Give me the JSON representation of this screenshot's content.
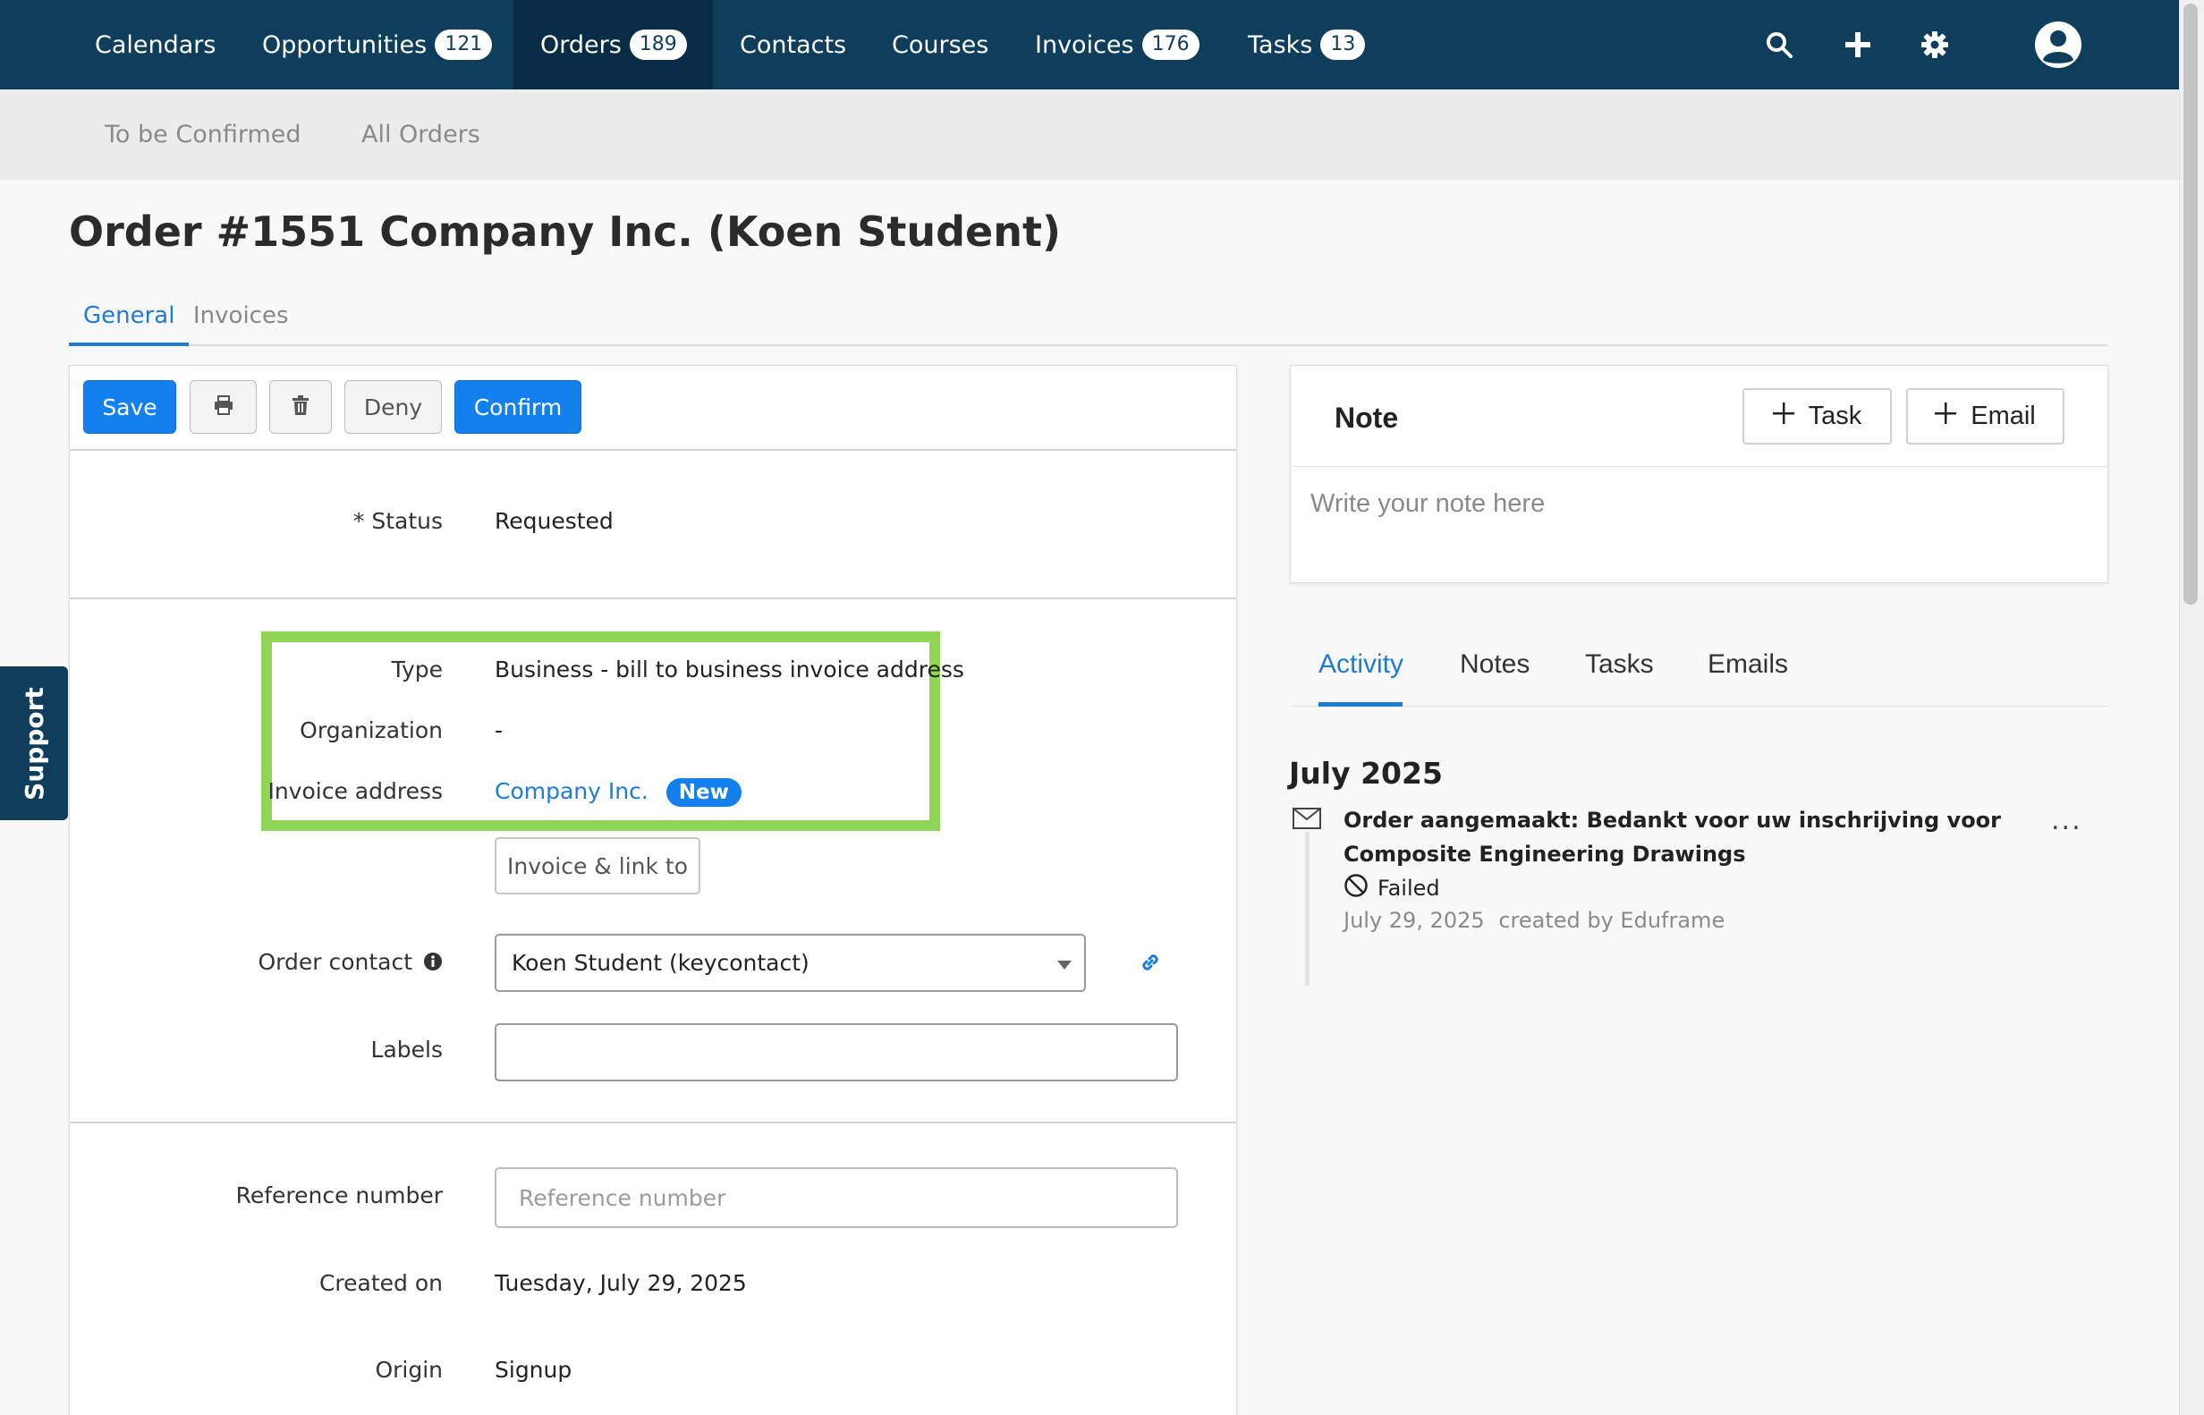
{
  "topnav": {
    "items": [
      {
        "label": "Calendars",
        "badge": null
      },
      {
        "label": "Opportunities",
        "badge": "121"
      },
      {
        "label": "Orders",
        "badge": "189"
      },
      {
        "label": "Contacts",
        "badge": null
      },
      {
        "label": "Courses",
        "badge": null
      },
      {
        "label": "Invoices",
        "badge": "176"
      },
      {
        "label": "Tasks",
        "badge": "13"
      }
    ],
    "active": "Orders",
    "icons": [
      "search-icon",
      "plus-icon",
      "gear-icon",
      "user-avatar-icon"
    ]
  },
  "subnav": {
    "items": [
      "To be Confirmed",
      "All Orders"
    ]
  },
  "page": {
    "title": "Order #1551 Company Inc. (Koen Student)"
  },
  "tabs": {
    "items": [
      "General",
      "Invoices"
    ],
    "active": "General"
  },
  "toolbar": {
    "save": "Save",
    "print_icon": "print-icon",
    "delete_icon": "trash-icon",
    "deny": "Deny",
    "confirm": "Confirm"
  },
  "form": {
    "status_label": "* Status",
    "status_value": "Requested",
    "type_label": "Type",
    "type_value": "Business - bill to business invoice address",
    "org_label": "Organization",
    "org_value": "-",
    "invoice_address_label": "Invoice address",
    "invoice_address_value": "Company Inc.",
    "invoice_address_badge": "New",
    "invoice_link_button": "Invoice & link to",
    "order_contact_label": "Order contact",
    "order_contact_value": "Koen Student (keycontact)",
    "labels_label": "Labels",
    "labels_value": "",
    "reference_label": "Reference number",
    "reference_placeholder": "Reference number",
    "created_label": "Created on",
    "created_value": "Tuesday, July 29, 2025",
    "origin_label": "Origin",
    "origin_value": "Signup"
  },
  "note": {
    "title": "Note",
    "task_button": "Task",
    "email_button": "Email",
    "placeholder": "Write your note here"
  },
  "activity": {
    "tabs": [
      "Activity",
      "Notes",
      "Tasks",
      "Emails"
    ],
    "active": "Activity",
    "month": "July 2025",
    "entries": [
      {
        "title": "Order aangemaakt: Bedankt voor uw inschrijving voor Composite Engineering Drawings",
        "status": "Failed",
        "date": "July 29, 2025",
        "author": "created by Eduframe",
        "more": "..."
      }
    ]
  },
  "support": {
    "label": "Support"
  },
  "colors": {
    "nav_bg": "#0f3d5c",
    "primary": "#1380ee",
    "link": "#1e7bd6",
    "highlight": "#8ed654"
  }
}
